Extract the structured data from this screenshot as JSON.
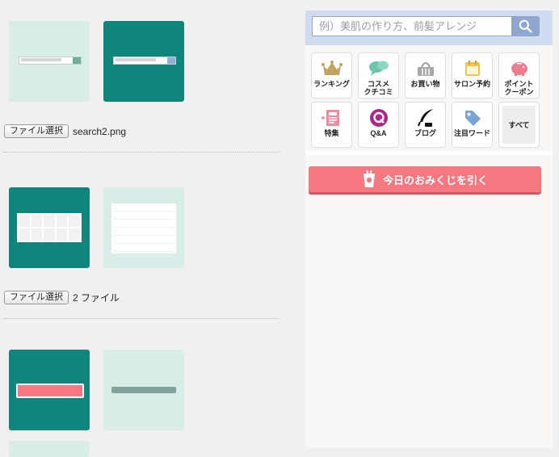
{
  "uploads": [
    {
      "button_label": "ファイル選択",
      "file_name": "search2.png"
    },
    {
      "button_label": "ファイル選択",
      "file_name": "2 ファイル"
    }
  ],
  "search": {
    "placeholder": "例）美肌の作り方、前髪アレンジ",
    "icon": "search-icon"
  },
  "menu": [
    {
      "label": "ランキング",
      "icon": "crown-icon"
    },
    {
      "label": "コスメ\nクチコミ",
      "icon": "speech-bubbles-icon"
    },
    {
      "label": "お買い物",
      "icon": "basket-icon"
    },
    {
      "label": "サロン予約",
      "icon": "calendar-icon"
    },
    {
      "label": "ポイント\nクーポン",
      "icon": "piggy-bank-icon"
    },
    {
      "label": "特集",
      "icon": "newspaper-icon"
    },
    {
      "label": "Q&A",
      "icon": "q-icon"
    },
    {
      "label": "ブログ",
      "icon": "quill-pen-icon"
    },
    {
      "label": "注目ワード",
      "icon": "tag-icon"
    },
    {
      "label": "すべて",
      "icon": ""
    }
  ],
  "omikuji": {
    "label": "今日のおみくじを引く",
    "icon": "omikuji-cylinder-icon"
  },
  "colors": {
    "teal": "#0f857c",
    "mint": "#d8ede7",
    "search_blue": "#8fa7cf",
    "omikuji_red": "#f5777f"
  }
}
